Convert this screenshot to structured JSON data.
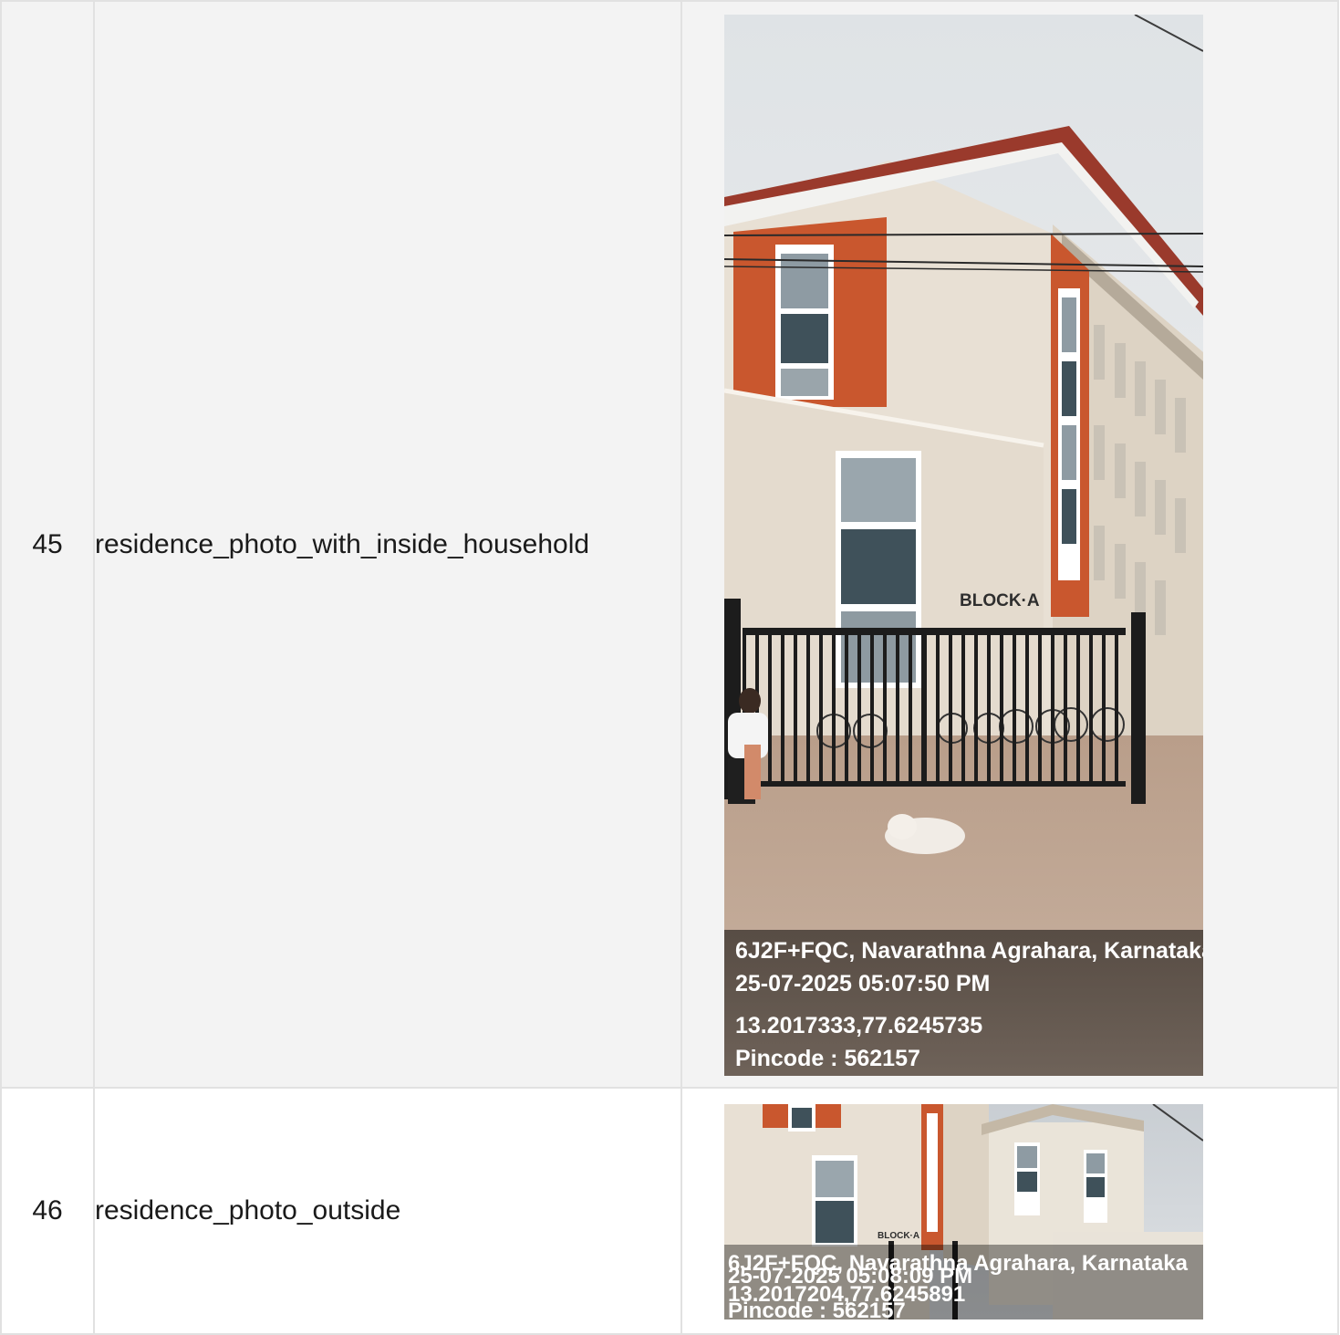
{
  "rows": [
    {
      "index": "45",
      "field": "residence_photo_with_inside_household",
      "photo": {
        "sign": "BLOCK·A",
        "overlay": {
          "line1": "6J2F+FQC, Navarathna Agrahara, Karnataka",
          "line2": "25-07-2025 05:07:50 PM",
          "line3": "13.2017333,77.6245735",
          "line4": "Pincode : 562157"
        }
      }
    },
    {
      "index": "46",
      "field": "residence_photo_outside",
      "photo": {
        "sign": "BLOCK·A",
        "overlay": {
          "line1": "6J2F+FQC, Navarathna Agrahara, Karnataka",
          "line2": "25-07-2025 05:08:09 PM",
          "line3": "13.2017204,77.6245891",
          "line4": "Pincode : 562157"
        }
      }
    }
  ],
  "colors": {
    "border": "#e1e1e1",
    "row_alt_bg": "#f3f3f3",
    "wall": "#e8e0d4",
    "accent_panel": "#c9572e",
    "roof": "#9a3a2c"
  }
}
